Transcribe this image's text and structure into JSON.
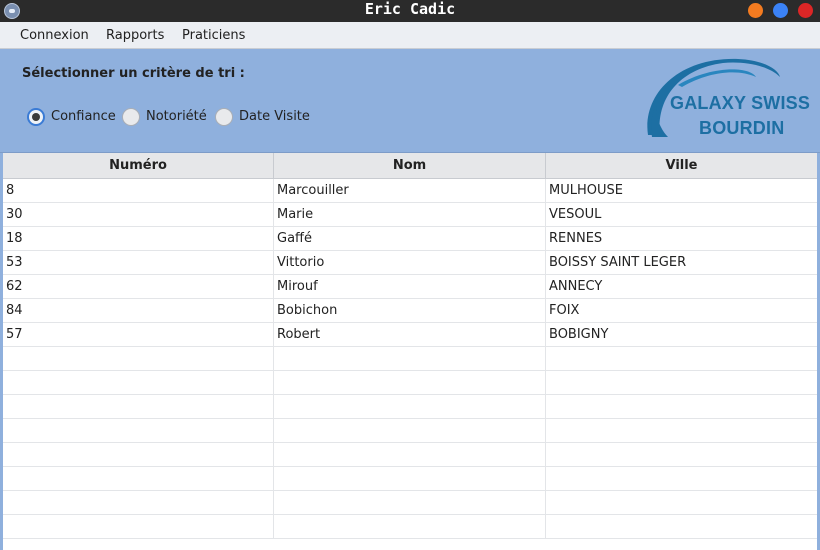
{
  "window": {
    "title": "Eric Cadic"
  },
  "menu": [
    "Connexion",
    "Rapports",
    "Praticiens"
  ],
  "panel": {
    "title": "Sélectionner un critère de tri :",
    "options": [
      {
        "label": "Confiance",
        "checked": true
      },
      {
        "label": "Notoriété",
        "checked": false
      },
      {
        "label": "Date Visite",
        "checked": false
      }
    ]
  },
  "logo": {
    "line1": "GALAXY SWISS",
    "line2": "BOURDIN"
  },
  "table": {
    "headers": [
      "Numéro",
      "Nom",
      "Ville"
    ],
    "rows": [
      [
        "8",
        "Marcouiller",
        "MULHOUSE"
      ],
      [
        "30",
        "Marie",
        "VESOUL"
      ],
      [
        "18",
        "Gaffé",
        "RENNES"
      ],
      [
        "53",
        "Vittorio",
        "BOISSY SAINT LEGER"
      ],
      [
        "62",
        "Mirouf",
        "ANNECY"
      ],
      [
        "84",
        "Bobichon",
        "FOIX"
      ],
      [
        "57",
        "Robert",
        "BOBIGNY"
      ]
    ]
  },
  "colors": {
    "panel": "#8fb0dd",
    "logo": "#1d6fa3",
    "titlebar": "#2b2b2b"
  },
  "icons": {
    "app": "app-icon",
    "minimize": "minimize-icon",
    "maximize": "maximize-icon",
    "close": "close-icon"
  }
}
